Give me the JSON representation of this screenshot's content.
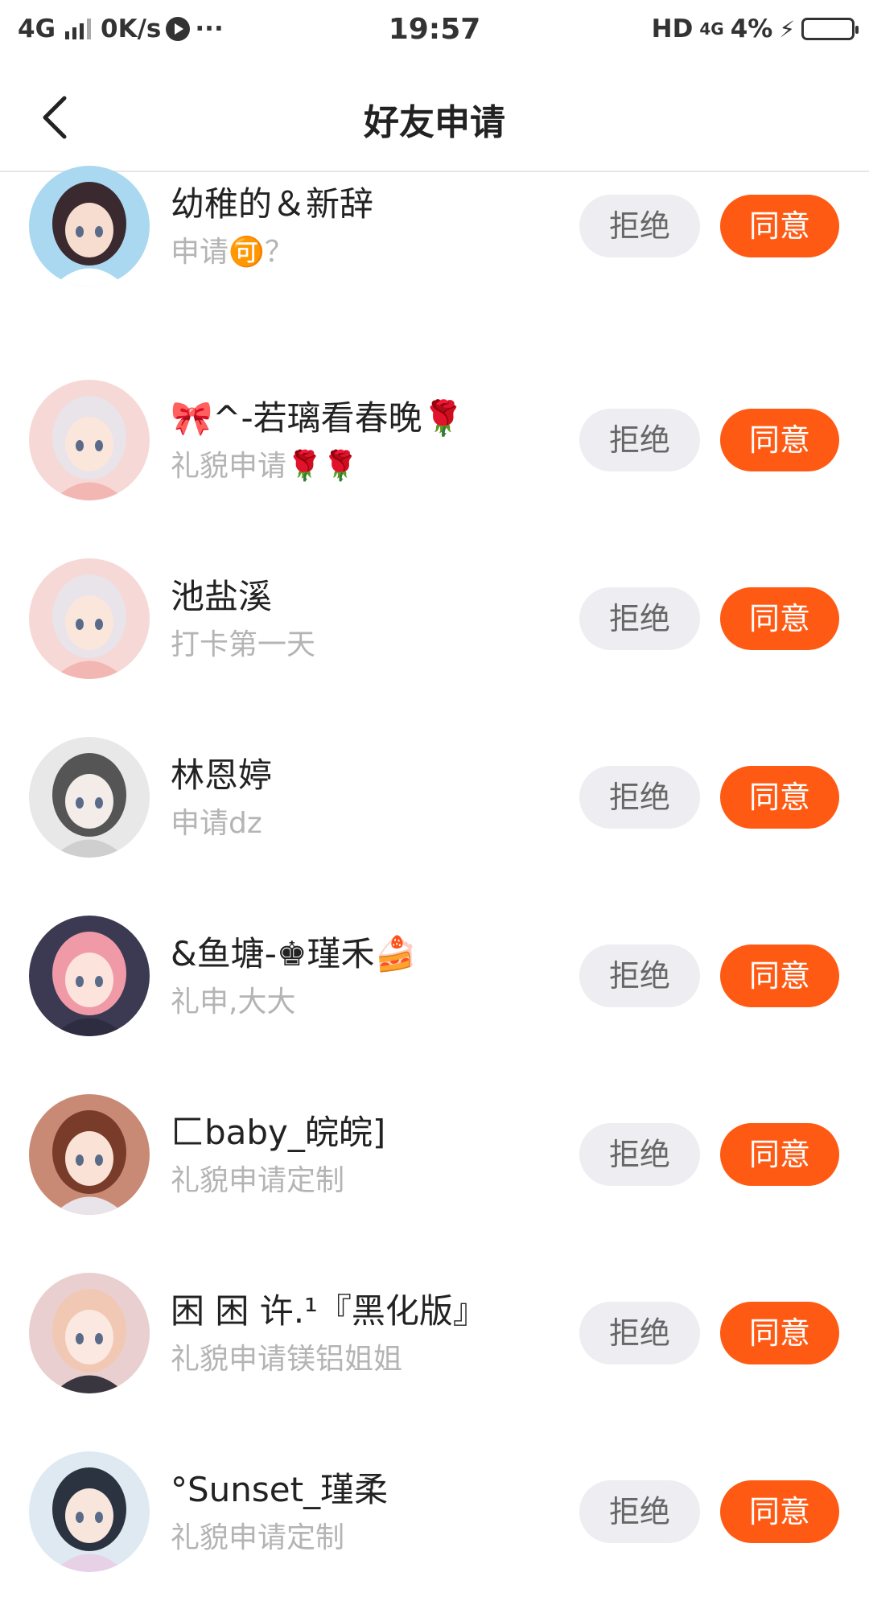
{
  "status_bar": {
    "network": "4G",
    "speed": "0K/s",
    "more": "···",
    "time": "19:57",
    "hd": "HD",
    "network_right": "4G",
    "battery": "4%"
  },
  "header": {
    "title": "好友申请"
  },
  "buttons": {
    "reject": "拒绝",
    "accept": "同意"
  },
  "requests": [
    {
      "name": "幼稚的＆新辞",
      "message": "申请🉑？",
      "avatar": "avatar-girl-beach"
    },
    {
      "name": "🎀^-若璃看春晚🌹",
      "message": "礼貌申请🌹🌹",
      "avatar": "avatar-girl-pink-hat"
    },
    {
      "name": "池盐溪",
      "message": "打卡第一天",
      "avatar": "avatar-girl-pink-hat"
    },
    {
      "name": "林恩婷",
      "message": "申请dz",
      "avatar": "avatar-girl-sketch"
    },
    {
      "name": "&鱼塘-♚瑾禾🍰",
      "message": "礼申,大大",
      "avatar": "avatar-girl-pink-hair"
    },
    {
      "name": "匚baby_皖皖]",
      "message": "礼貌申请定制",
      "avatar": "avatar-girl-brown-hair"
    },
    {
      "name": "困 困 许.¹『黑化版』",
      "message": "礼貌申请镁铝姐姐",
      "avatar": "avatar-girl-blonde"
    },
    {
      "name": "°Sunset_瑾柔",
      "message": "礼貌申请定制",
      "avatar": "avatar-girl-dark-hair"
    }
  ],
  "colors": {
    "accent": "#ff5a14",
    "reject_bg": "#ededf2",
    "secondary_text": "#b4b4b4"
  }
}
